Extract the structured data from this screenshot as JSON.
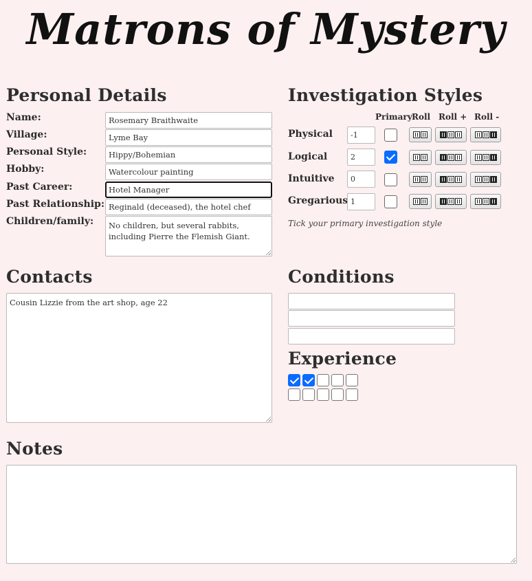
{
  "title": "Matrons of Mystery",
  "personal": {
    "heading": "Personal Details",
    "fields": [
      {
        "label": "Name:",
        "value": "Rosemary Braithwaite"
      },
      {
        "label": "Village:",
        "value": "Lyme Bay"
      },
      {
        "label": "Personal Style:",
        "value": "Hippy/Bohemian"
      },
      {
        "label": "Hobby:",
        "value": "Watercolour painting"
      },
      {
        "label": "Past Career:",
        "value": "Hotel Manager"
      },
      {
        "label": "Past Relationship:",
        "value": "Reginald (deceased), the hotel chef"
      },
      {
        "label": "Children/family:",
        "value": "No children, but several rabbits, including Pierre the Flemish Giant."
      }
    ]
  },
  "investigation": {
    "heading": "Investigation Styles",
    "columns": {
      "primary": "Primary",
      "roll": "Roll",
      "roll_plus": "Roll +",
      "roll_minus": "Roll -"
    },
    "styles": [
      {
        "name": "Physical",
        "value": "-1",
        "primary": false
      },
      {
        "name": "Logical",
        "value": "2",
        "primary": true
      },
      {
        "name": "Intuitive",
        "value": "0",
        "primary": false
      },
      {
        "name": "Gregarious",
        "value": "1",
        "primary": false
      }
    ],
    "hint": "Tick your primary investigation style"
  },
  "contacts": {
    "heading": "Contacts",
    "value": "Cousin Lizzie from the art shop, age 22"
  },
  "conditions": {
    "heading": "Conditions",
    "values": [
      "",
      "",
      ""
    ]
  },
  "experience": {
    "heading": "Experience",
    "boxes": [
      true,
      true,
      false,
      false,
      false,
      false,
      false,
      false,
      false,
      false
    ]
  },
  "notes": {
    "heading": "Notes",
    "value": ""
  },
  "colors": {
    "background": "#fdf0f0",
    "check_accent": "#0a6cff"
  },
  "icons": {
    "roll": "two-dice-icon",
    "roll_plus": "three-dice-icon",
    "roll_minus": "three-dice-icon"
  }
}
